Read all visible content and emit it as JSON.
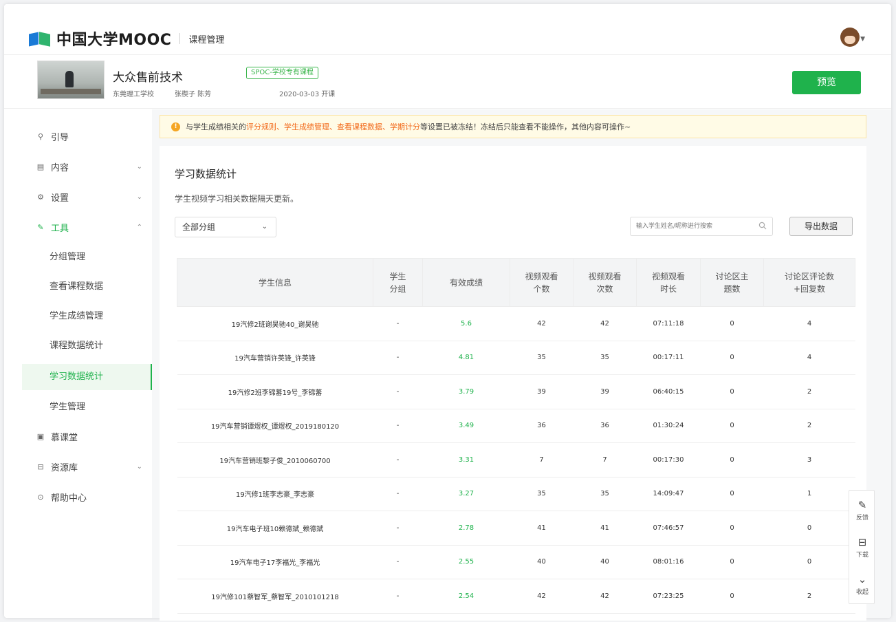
{
  "header": {
    "brand": "中国大学MOOC",
    "section": "课程管理"
  },
  "course": {
    "title": "大众售前技术",
    "tag": "SPOC-学校专有课程",
    "school": "东莞理工学校",
    "teachers": "张楔子 陈芳",
    "start_date": "2020-03-03 开课",
    "preview_label": "预览"
  },
  "sidebar": {
    "items": [
      {
        "icon": "pin-icon",
        "label": "引导"
      },
      {
        "icon": "document-icon",
        "label": "内容"
      },
      {
        "icon": "gear-icon",
        "label": "设置"
      },
      {
        "icon": "wrench-icon",
        "label": "工具"
      },
      {
        "icon": "classroom-icon",
        "label": "慕课堂"
      },
      {
        "icon": "database-icon",
        "label": "资源库"
      },
      {
        "icon": "help-icon",
        "label": "帮助中心"
      }
    ],
    "tool_sub_items": [
      "分组管理",
      "查看课程数据",
      "学生成绩管理",
      "课程数据统计",
      "学习数据统计",
      "学生管理"
    ]
  },
  "notice": {
    "prefix": "与学生成绩相关的",
    "highlight": "评分规则、学生成绩管理、查看课程数据、学期计分",
    "suffix": "等设置已被冻结！冻结后只能查看不能操作，其他内容可操作~"
  },
  "main": {
    "title": "学习数据统计",
    "description": "学生视频学习相关数据隔天更新。",
    "group_filter": "全部分组",
    "search_placeholder": "输入学生姓名/昵称进行搜索",
    "export_label": "导出数据"
  },
  "table": {
    "headers": [
      "学生信息",
      "学生\n分组",
      "有效成绩",
      "视频观看\n个数",
      "视频观看\n次数",
      "视频观看\n时长",
      "讨论区主\n题数",
      "讨论区评论数\n+回复数"
    ],
    "rows": [
      [
        "19汽修2班谢昊驰40_谢昊驰",
        "-",
        "5.6",
        "42",
        "42",
        "07:11:18",
        "0",
        "4"
      ],
      [
        "19汽车营销许英锋_许英锋",
        "-",
        "4.81",
        "35",
        "35",
        "00:17:11",
        "0",
        "4"
      ],
      [
        "19汽修2班李锦蕃19号_李锦蕃",
        "-",
        "3.79",
        "39",
        "39",
        "06:40:15",
        "0",
        "2"
      ],
      [
        "19汽车营销谭煜权_谭煜权_2019180120",
        "-",
        "3.49",
        "36",
        "36",
        "01:30:24",
        "0",
        "2"
      ],
      [
        "19汽车营销班黎子俊_2010060700",
        "-",
        "3.31",
        "7",
        "7",
        "00:17:30",
        "0",
        "3"
      ],
      [
        "19汽修1班李志豪_李志豪",
        "-",
        "3.27",
        "35",
        "35",
        "14:09:47",
        "0",
        "1"
      ],
      [
        "19汽车电子班10赖德斌_赖德斌",
        "-",
        "2.78",
        "41",
        "41",
        "07:46:57",
        "0",
        "0"
      ],
      [
        "19汽车电子17李福光_李福光",
        "-",
        "2.55",
        "40",
        "40",
        "08:01:16",
        "0",
        "0"
      ],
      [
        "19汽修101蔡智军_蔡智军_2010101218",
        "-",
        "2.54",
        "42",
        "42",
        "07:23:25",
        "0",
        "2"
      ]
    ]
  },
  "float_tools": [
    {
      "icon": "edit-icon",
      "label": "反馈"
    },
    {
      "icon": "download-icon",
      "label": "下载"
    },
    {
      "icon": "collapse-icon",
      "label": "收起"
    }
  ],
  "colors": {
    "accent": "#1fb24c",
    "warning": "#f26b1d"
  }
}
